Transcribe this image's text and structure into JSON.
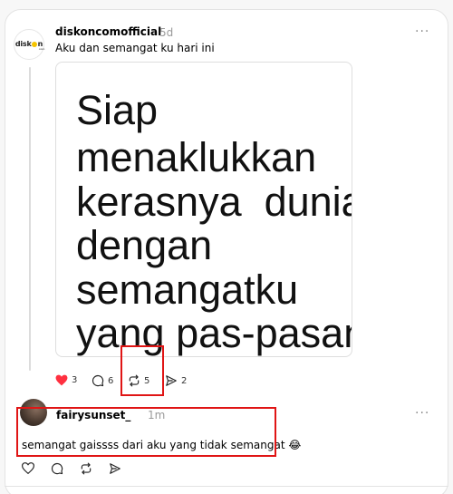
{
  "post": {
    "username": "diskoncomofficial",
    "time": "5d",
    "caption": "Aku dan semangat ku hari ini",
    "more_label": "···",
    "avatar_logo": {
      "left": "disk",
      "right": "n",
      "sub": "com"
    },
    "image_text": [
      "Siap",
      "menaklukkan",
      "kerasnya  dunia",
      "dengan",
      "semangatku",
      "yang pas-pasan."
    ],
    "actions": {
      "like_count": "3",
      "comment_count": "6",
      "repost_count": "5",
      "share_count": "2"
    },
    "liked": true,
    "like_color": "#ff3040"
  },
  "reply": {
    "username": "fairysunset_",
    "time": "1m",
    "more_label": "···",
    "text": "semangat gaissss dari aku yang tidak semangat 😂"
  },
  "highlight_color": "#e01515",
  "icons": [
    "heart-icon",
    "comment-icon",
    "repost-icon",
    "share-icon",
    "more-icon"
  ]
}
